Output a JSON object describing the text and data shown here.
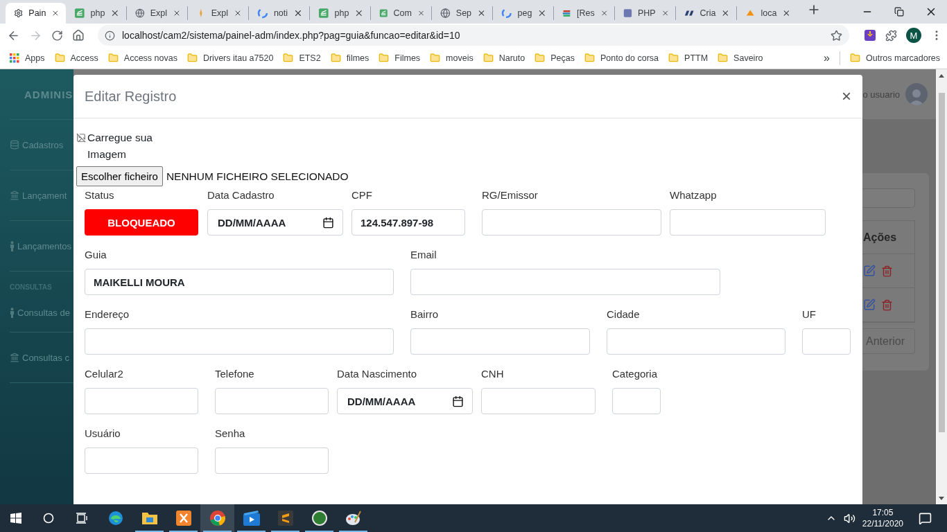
{
  "browser": {
    "tabs": [
      {
        "title": "Pain",
        "selected": true
      },
      {
        "title": "php",
        "selected": false
      },
      {
        "title": "Expl",
        "selected": false
      },
      {
        "title": "Expl",
        "selected": false
      },
      {
        "title": "noti",
        "selected": false
      },
      {
        "title": "php",
        "selected": false
      },
      {
        "title": "Com",
        "selected": false
      },
      {
        "title": "Sep",
        "selected": false
      },
      {
        "title": "peg",
        "selected": false
      },
      {
        "title": "[Res",
        "selected": false
      },
      {
        "title": "PHP",
        "selected": false
      },
      {
        "title": "Cria",
        "selected": false
      },
      {
        "title": "loca",
        "selected": false
      }
    ],
    "url": "localhost/cam2/sistema/painel-adm/index.php?pag=guia&funcao=editar&id=10",
    "profile_initial": "M",
    "apps_label": "Apps",
    "bookmarks": [
      "Access",
      "Access novas",
      "Drivers itau a7520",
      "ETS2",
      "filmes",
      "Filmes",
      "moveis",
      "Naruto",
      "Peças",
      "Ponto do corsa",
      "PTTM",
      "Saveiro"
    ],
    "more_bookmarks": "»",
    "other_bookmarks": "Outros marcadores"
  },
  "sidebar": {
    "title": "ADMINIS",
    "entries": [
      {
        "kind": "item",
        "label": "Cadastros"
      },
      {
        "kind": "item",
        "label": "Lançament"
      },
      {
        "kind": "item",
        "label": "Lançamentos"
      },
      {
        "kind": "heading",
        "label": "CONSULTAS"
      },
      {
        "kind": "item",
        "label": "Consultas de"
      },
      {
        "kind": "item",
        "label": "Consultas c"
      }
    ]
  },
  "background": {
    "user_label": "o usuario",
    "column_header": "Ações",
    "pager_button": "Anterior"
  },
  "modal": {
    "title": "Editar Registro",
    "close": "×",
    "image_alt": "Carregue sua Imagem",
    "file_button": "Escolher ficheiro",
    "file_status": "NENHUM FICHEIRO SELECIONADO",
    "form_rows": [
      [
        {
          "label": "Status",
          "kind": "select",
          "value": "BLOQUEADO"
        },
        {
          "label": "Data Cadastro",
          "kind": "date",
          "placeholder": "DD/MM/AAAA"
        },
        {
          "label": "CPF",
          "kind": "text",
          "value": "124.547.897-98"
        },
        {
          "label": "RG/Emissor",
          "kind": "text"
        },
        {
          "label": "Whatzapp",
          "kind": "text"
        }
      ],
      [
        {
          "label": "Guia",
          "kind": "text",
          "value": "MAIKELLI MOURA"
        },
        {
          "label": "Email",
          "kind": "text"
        }
      ],
      [
        {
          "label": "Endereço",
          "kind": "text"
        },
        {
          "label": "Bairro",
          "kind": "text"
        },
        {
          "label": "Cidade",
          "kind": "text"
        },
        {
          "label": "UF",
          "kind": "text"
        }
      ],
      [
        {
          "label": "Celular2",
          "kind": "text"
        },
        {
          "label": "Telefone",
          "kind": "text"
        },
        {
          "label": "Data Nascimento",
          "kind": "date",
          "placeholder": "DD/MM/AAAA"
        },
        {
          "label": "CNH",
          "kind": "text"
        },
        {
          "label": "Categoria",
          "kind": "text"
        }
      ],
      [
        {
          "label": "Usuário",
          "kind": "text"
        },
        {
          "label": "Senha",
          "kind": "text"
        }
      ]
    ]
  },
  "taskbar": {
    "apps": [
      {
        "running": false,
        "selected": false
      },
      {
        "running": true,
        "selected": false
      },
      {
        "running": true,
        "selected": false
      },
      {
        "running": true,
        "selected": true
      },
      {
        "running": true,
        "selected": false
      },
      {
        "running": true,
        "selected": false
      },
      {
        "running": true,
        "selected": false
      },
      {
        "running": true,
        "selected": false
      }
    ],
    "time": "17:05",
    "date": "22/11/2020"
  }
}
